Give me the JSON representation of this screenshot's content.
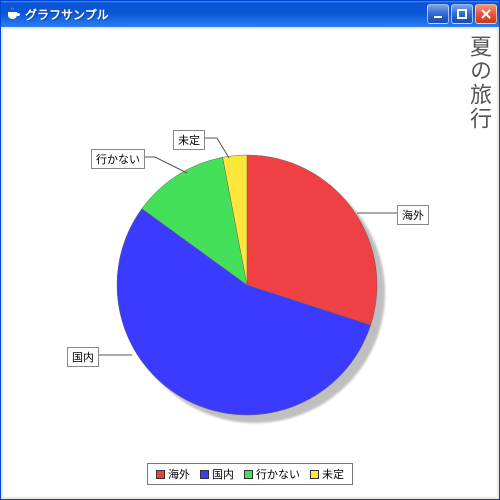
{
  "window": {
    "title": "グラフサンプル",
    "app_icon": "java-coffee-icon"
  },
  "sidebar_title": "夏の旅行",
  "chart_data": {
    "type": "pie",
    "title": "夏の旅行",
    "series": [
      {
        "name": "海外",
        "value": 30,
        "color": "#ef4044"
      },
      {
        "name": "国内",
        "value": 55,
        "color": "#3b3bff"
      },
      {
        "name": "行かない",
        "value": 12,
        "color": "#44e05a"
      },
      {
        "name": "未定",
        "value": 3,
        "color": "#ffe63a"
      }
    ],
    "legend_position": "bottom"
  },
  "legend_items": [
    {
      "label": "海外",
      "color": "#ef4044"
    },
    {
      "label": "国内",
      "color": "#3b3bff"
    },
    {
      "label": "行かない",
      "color": "#44e05a"
    },
    {
      "label": "未定",
      "color": "#ffe63a"
    }
  ],
  "slice_labels": {
    "kaigai": "海外",
    "kokunai": "国内",
    "ikanai": "行かない",
    "mitei": "未定"
  }
}
